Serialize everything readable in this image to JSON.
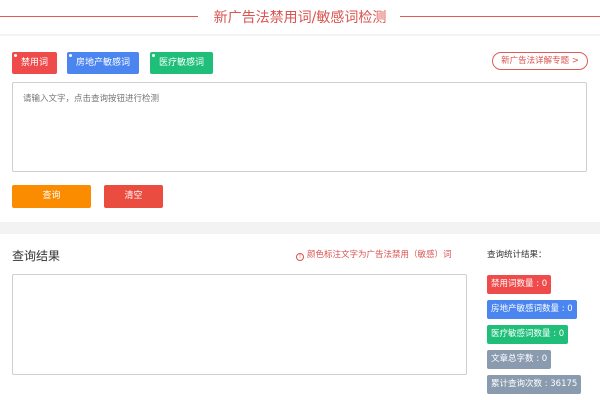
{
  "header": {
    "title": "新广告法禁用词/敏感词检测"
  },
  "tags": [
    {
      "label": "禁用词",
      "color": "#f04b4b"
    },
    {
      "label": "房地产敏感词",
      "color": "#4b85f0"
    },
    {
      "label": "医疗敏感词",
      "color": "#1fbf7a"
    }
  ],
  "topic_link": {
    "label": "新广告法详解专题 >"
  },
  "input": {
    "value": "",
    "placeholder": "请输入文字，点击查询按钮进行检测"
  },
  "buttons": {
    "query": "查询",
    "clear": "清空"
  },
  "results": {
    "title": "查询结果",
    "note": "颜色标注文字为广告法禁用（敏感）词"
  },
  "stats": {
    "title": "查询统计结果：",
    "items": [
      {
        "label": "禁用词数量 : 0",
        "color": "#f04b4b"
      },
      {
        "label": "房地产敏感词数量 : 0",
        "color": "#4b85f0"
      },
      {
        "label": "医疗敏感词数量 : 0",
        "color": "#1fbf7a"
      },
      {
        "label": "文章总字数 : 0",
        "color": "#8a9bb0"
      },
      {
        "label": "累计查询次数 : 36175",
        "color": "#8a9bb0"
      }
    ]
  }
}
